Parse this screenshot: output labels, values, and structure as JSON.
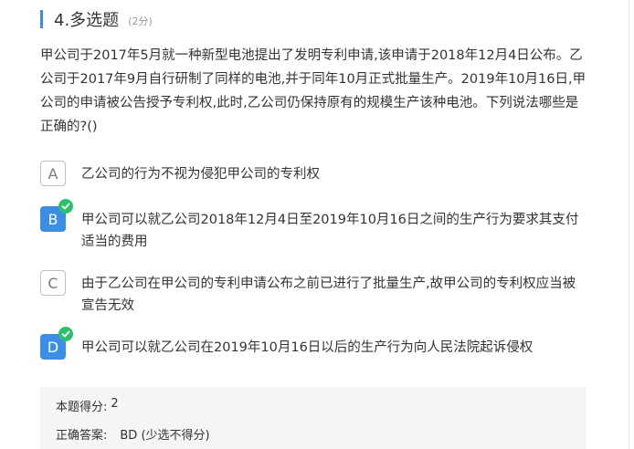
{
  "question": {
    "title": "4.多选题",
    "points": "(2分)",
    "stem": "甲公司于2017年5月就一种新型电池提出了发明专利申请,该申请于2018年12月4日公布。乙公司于2017年9月自行研制了同样的电池,并于同年10月正式批量生产。2019年10月16日,甲公司的申请被公告授予专利权,此时,乙公司仍保持原有的规模生产该种电池。下列说法哪些是正确的?()"
  },
  "options": [
    {
      "letter": "A",
      "text": "乙公司的行为不视为侵犯甲公司的专利权",
      "selected": false
    },
    {
      "letter": "B",
      "text": "甲公司可以就乙公司2018年12月4日至2019年10月16日之间的生产行为要求其支付适当的费用",
      "selected": true
    },
    {
      "letter": "C",
      "text": "由于乙公司在甲公司的专利申请公布之前已进行了批量生产,故甲公司的专利权应当被宣告无效",
      "selected": false
    },
    {
      "letter": "D",
      "text": "甲公司可以就乙公司在2019年10月16日以后的生产行为向人民法院起诉侵权",
      "selected": true
    }
  ],
  "result": {
    "score_label": "本题得分:",
    "score_value": "2",
    "answer_label": "正确答案:",
    "answer_value": "BD (少选不得分)"
  },
  "colors": {
    "accent": "#3a8ee6",
    "check": "#2ebf6e",
    "panel": "#f5f5f5"
  },
  "icons": {
    "check": "checkmark-icon"
  }
}
